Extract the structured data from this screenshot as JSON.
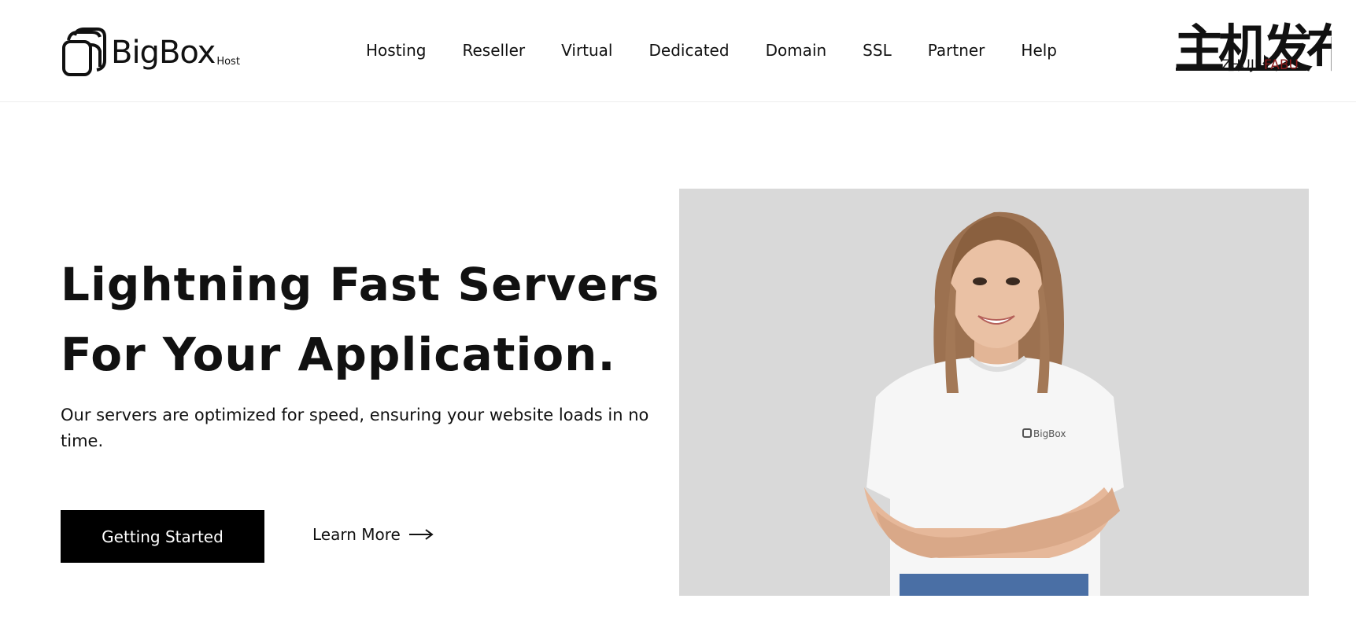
{
  "header": {
    "logo": {
      "text": "BigBox",
      "sub": "Host"
    },
    "nav": [
      {
        "label": "Hosting"
      },
      {
        "label": "Reseller"
      },
      {
        "label": "Virtual"
      },
      {
        "label": "Dedicated"
      },
      {
        "label": "Domain"
      },
      {
        "label": "SSL"
      },
      {
        "label": "Partner"
      },
      {
        "label": "Help"
      }
    ],
    "watermark": {
      "main": "主机发布",
      "latin_left": "ZHUJI",
      "latin_right": "FABU"
    }
  },
  "hero": {
    "title_line1": "Lightning Fast Servers",
    "title_line2": "For Your Application.",
    "description": "Our servers are optimized for speed, ensuring your website loads in no time.",
    "primary_button": "Getting Started",
    "secondary_link": "Learn More",
    "shirt_logo": "BigBox"
  },
  "colors": {
    "accent": "#000000",
    "image_bg": "#d9d9d9",
    "watermark_red": "#8b1a1a"
  }
}
